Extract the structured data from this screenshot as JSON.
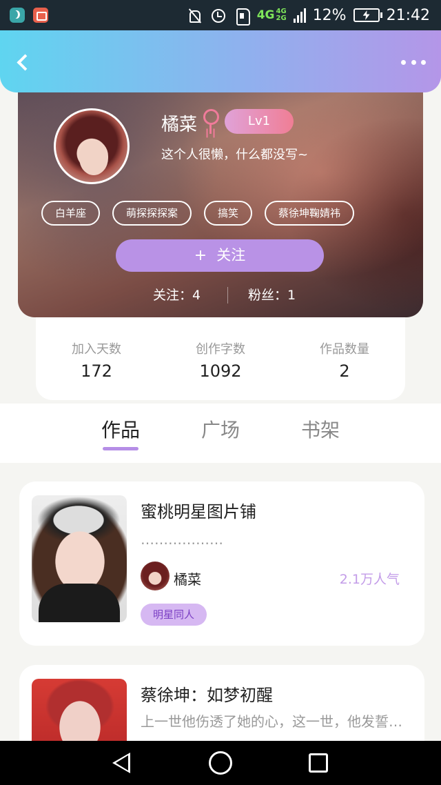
{
  "status_bar": {
    "network_big": "4G",
    "network_small_top": "4G",
    "network_small_bottom": "2G",
    "battery": "12%",
    "time": "21:42"
  },
  "profile": {
    "name": "橘菜",
    "level": "Lv1",
    "bio": "这个人很懒，什么都没写~",
    "tags": [
      "白羊座",
      "萌探探探案",
      "搞笑",
      "蔡徐坤鞠婧祎"
    ],
    "follow_plus": "+",
    "follow_label": "关注",
    "following_text": "关注：4",
    "fans_text": "粉丝：1"
  },
  "stats": [
    {
      "label": "加入天数",
      "value": "172"
    },
    {
      "label": "创作字数",
      "value": "1092"
    },
    {
      "label": "作品数量",
      "value": "2"
    }
  ],
  "tabs": [
    "作品",
    "广场",
    "书架"
  ],
  "active_tab": "作品",
  "works": [
    {
      "title": "蜜桃明星图片铺",
      "desc": "………………",
      "author": "橘菜",
      "popularity": "2.1万人气",
      "category": "明星同人"
    },
    {
      "title": "蔡徐坤：如梦初醒",
      "desc": "上一世他伤透了她的心，这一世，他发誓…"
    }
  ],
  "colors": {
    "accent": "#b992e6",
    "header_start": "#5fd5f0",
    "header_end": "#b496e8",
    "female": "#f07b9a"
  }
}
